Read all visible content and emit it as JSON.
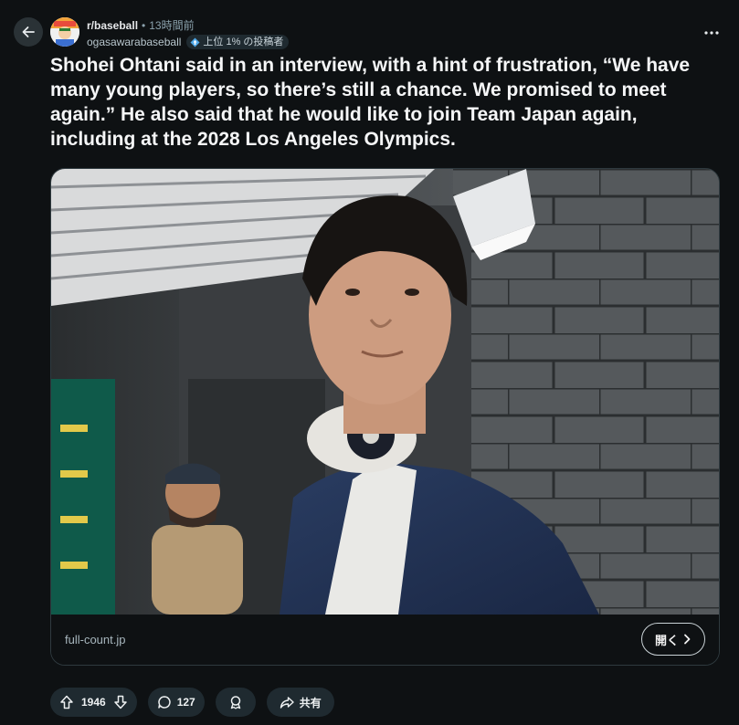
{
  "header": {
    "subreddit": "r/baseball",
    "separator": "•",
    "time_ago": "13時間前",
    "username": "ogasawarabaseball",
    "flair": "上位 1% の投稿者"
  },
  "post": {
    "title": "Shohei Ohtani said in an interview, with a hint of frustration, “We have many young players, so there’s still a chance. We promised to meet again.” He also said that he would like to join Team Japan again, including at the 2028 Los Angeles Olympics."
  },
  "link_card": {
    "domain": "full-count.jp",
    "open_label": "開く"
  },
  "actions": {
    "upvotes": "1946",
    "comments": "127",
    "share_label": "共有"
  },
  "icons": {
    "back": "back-arrow-icon",
    "more": "more-options-icon",
    "upvote": "upvote-icon",
    "downvote": "downvote-icon",
    "comment": "comment-icon",
    "award": "award-icon",
    "share": "share-icon",
    "external": "chevron-right-icon"
  },
  "colors": {
    "background": "#0e1113",
    "pill": "#1f2a30",
    "text": "#f2f2f2",
    "muted": "#8ba2ad"
  }
}
